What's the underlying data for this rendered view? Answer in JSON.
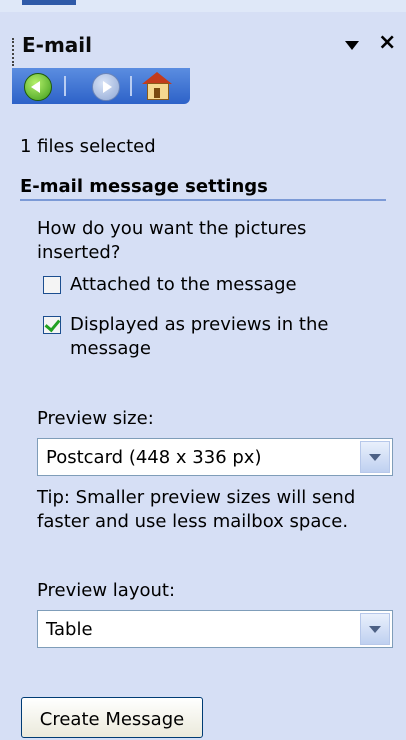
{
  "panel": {
    "title": "E-mail",
    "menu_icon": "dropdown-arrow-icon",
    "close_icon": "close-icon"
  },
  "nav": {
    "back_icon": "back-arrow-icon",
    "forward_icon": "forward-arrow-icon",
    "home_icon": "home-icon"
  },
  "status": "1 files selected",
  "section": {
    "title": "E-mail message settings",
    "question_line1": "How do you want the pictures",
    "question_line2": "inserted?",
    "options": [
      {
        "label": "Attached to the message",
        "checked": false
      },
      {
        "label_line1": "Displayed as previews in the",
        "label_line2": "message",
        "checked": true
      }
    ],
    "preview_size_label": "Preview size:",
    "preview_size_value": "Postcard (448 x 336 px)",
    "tip_line1": "Tip: Smaller preview sizes will send",
    "tip_line2": "faster and use less mailbox space.",
    "preview_layout_label": "Preview layout:",
    "preview_layout_value": "Table"
  },
  "actions": {
    "create_label": "Create Message"
  },
  "colors": {
    "panel_bg": "#d6dff5",
    "nav_blue": "#2d62c8",
    "check_green": "#21a121"
  }
}
